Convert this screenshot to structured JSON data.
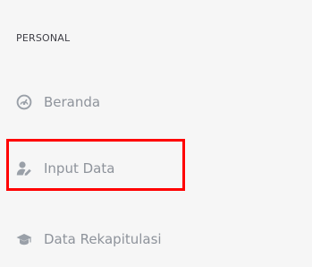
{
  "sidebar": {
    "section_title": "PERSONAL",
    "items": [
      {
        "label": "Beranda",
        "icon": "dashboard-icon"
      },
      {
        "label": "Input Data",
        "icon": "user-edit-icon",
        "highlighted": true
      },
      {
        "label": "Data Rekapitulasi",
        "icon": "graduation-cap-icon"
      }
    ]
  },
  "colors": {
    "panel_background": "#f6f6f6",
    "nav_text": "#8e939b",
    "highlight_border": "#ff0000"
  }
}
